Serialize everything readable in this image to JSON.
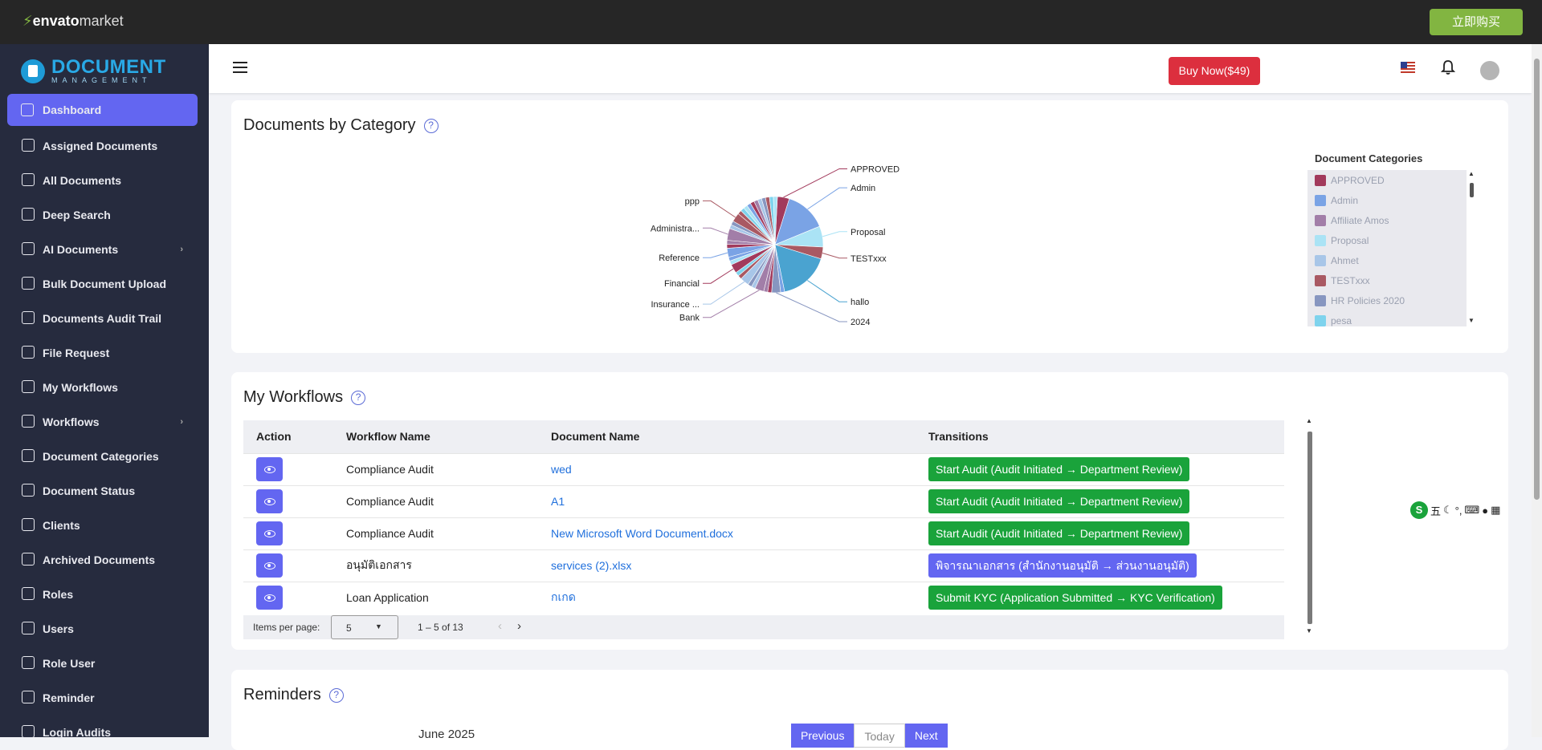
{
  "topbar": {
    "logo_brand": "envato",
    "logo_suffix": "market",
    "buy_label": "立即购买"
  },
  "brand": {
    "title": "DOCUMENT",
    "subtitle": "MANAGEMENT"
  },
  "sidebar": {
    "items": [
      {
        "label": "Dashboard",
        "icon": "layers-icon",
        "active": true
      },
      {
        "label": "Assigned Documents",
        "icon": "list-icon"
      },
      {
        "label": "All Documents",
        "icon": "file-icon"
      },
      {
        "label": "Deep Search",
        "icon": "search-icon"
      },
      {
        "label": "AI Documents",
        "icon": "chip-icon",
        "has_submenu": true
      },
      {
        "label": "Bulk Document Upload",
        "icon": "upload-icon"
      },
      {
        "label": "Documents Audit Trail",
        "icon": "activity-icon"
      },
      {
        "label": "File Request",
        "icon": "inbox-icon"
      },
      {
        "label": "My Workflows",
        "icon": "workflow-icon"
      },
      {
        "label": "Workflows",
        "icon": "activity-icon",
        "has_submenu": true
      },
      {
        "label": "Document Categories",
        "icon": "file-icon"
      },
      {
        "label": "Document Status",
        "icon": "check-icon"
      },
      {
        "label": "Clients",
        "icon": "users-icon"
      },
      {
        "label": "Archived Documents",
        "icon": "archive-icon"
      },
      {
        "label": "Roles",
        "icon": "users-icon"
      },
      {
        "label": "Users",
        "icon": "user-icon"
      },
      {
        "label": "Role User",
        "icon": "user-check-icon"
      },
      {
        "label": "Reminder",
        "icon": "bell-icon"
      },
      {
        "label": "Login Audits",
        "icon": "login-icon"
      }
    ]
  },
  "header": {
    "buy_now_label": "Buy Now($49)",
    "help_glyph": "?"
  },
  "category_card": {
    "title": "Documents by Category",
    "legend_title": "Document Categories",
    "legend": [
      {
        "label": "APPROVED",
        "color": "#a23a5c"
      },
      {
        "label": "Admin",
        "color": "#7aa3e5"
      },
      {
        "label": "Affiliate Amos",
        "color": "#a27ea8"
      },
      {
        "label": "Proposal",
        "color": "#aae3f5"
      },
      {
        "label": "Ahmet",
        "color": "#a8c6e8"
      },
      {
        "label": "TESTxxx",
        "color": "#a95963"
      },
      {
        "label": "HR Policies 2020",
        "color": "#8796c0"
      },
      {
        "label": "pesa",
        "color": "#7ed3ed"
      }
    ]
  },
  "chart_data": {
    "type": "pie",
    "title": "Documents by Category",
    "slices": [
      {
        "label": "APPROVED",
        "share": 0.04,
        "color": "#a23a5c"
      },
      {
        "label": "Admin",
        "share": 0.14,
        "color": "#7aa3e5"
      },
      {
        "label": "Proposal",
        "share": 0.07,
        "color": "#aae3f5"
      },
      {
        "label": "TESTxxx",
        "share": 0.04,
        "color": "#a95963"
      },
      {
        "label": "hallo",
        "share": 0.17,
        "color": "#4aa3d0"
      },
      {
        "label": "2024",
        "share": 0.03,
        "color": "#8796c0"
      },
      {
        "label": "Bank",
        "share": 0.03,
        "color": "#a27ea8"
      },
      {
        "label": "Insurance ...",
        "share": 0.03,
        "color": "#a8c6e8"
      },
      {
        "label": "Financial",
        "share": 0.03,
        "color": "#a23a5c"
      },
      {
        "label": "Reference",
        "share": 0.03,
        "color": "#7aa3e5"
      },
      {
        "label": "Administra...",
        "share": 0.04,
        "color": "#a27ea8"
      },
      {
        "label": "ppp",
        "share": 0.03,
        "color": "#a95963"
      }
    ],
    "legend_position": "right"
  },
  "workflows_card": {
    "title": "My Workflows",
    "columns": [
      "Action",
      "Workflow Name",
      "Document Name",
      "Transitions"
    ],
    "rows": [
      {
        "workflow": "Compliance Audit",
        "document": "wed",
        "transition": "Start Audit (Audit Initiated → Department Review)",
        "color": "green"
      },
      {
        "workflow": "Compliance Audit",
        "document": "A1",
        "transition": "Start Audit (Audit Initiated → Department Review)",
        "color": "green"
      },
      {
        "workflow": "Compliance Audit",
        "document": "New Microsoft Word Document.docx",
        "transition": "Start Audit (Audit Initiated → Department Review)",
        "color": "green"
      },
      {
        "workflow": "อนุมัติเอกสาร",
        "document": "services (2).xlsx",
        "transition": "พิจารณาเอกสาร (สำนักงานอนุมัติ → ส่วนงานอนุมัติ)",
        "color": "purple"
      },
      {
        "workflow": "Loan Application",
        "document": "กเกด",
        "transition": "Submit KYC (Application Submitted → KYC Verification)",
        "color": "green"
      }
    ],
    "paginator": {
      "items_per_page_label": "Items per page:",
      "page_size": "5",
      "range_label": "1 – 5 of 13"
    }
  },
  "reminders_card": {
    "title": "Reminders",
    "month_label": "June 2025",
    "prev_label": "Previous",
    "today_label": "Today",
    "next_label": "Next"
  },
  "ime": {
    "logo": "S",
    "mode": "五"
  }
}
